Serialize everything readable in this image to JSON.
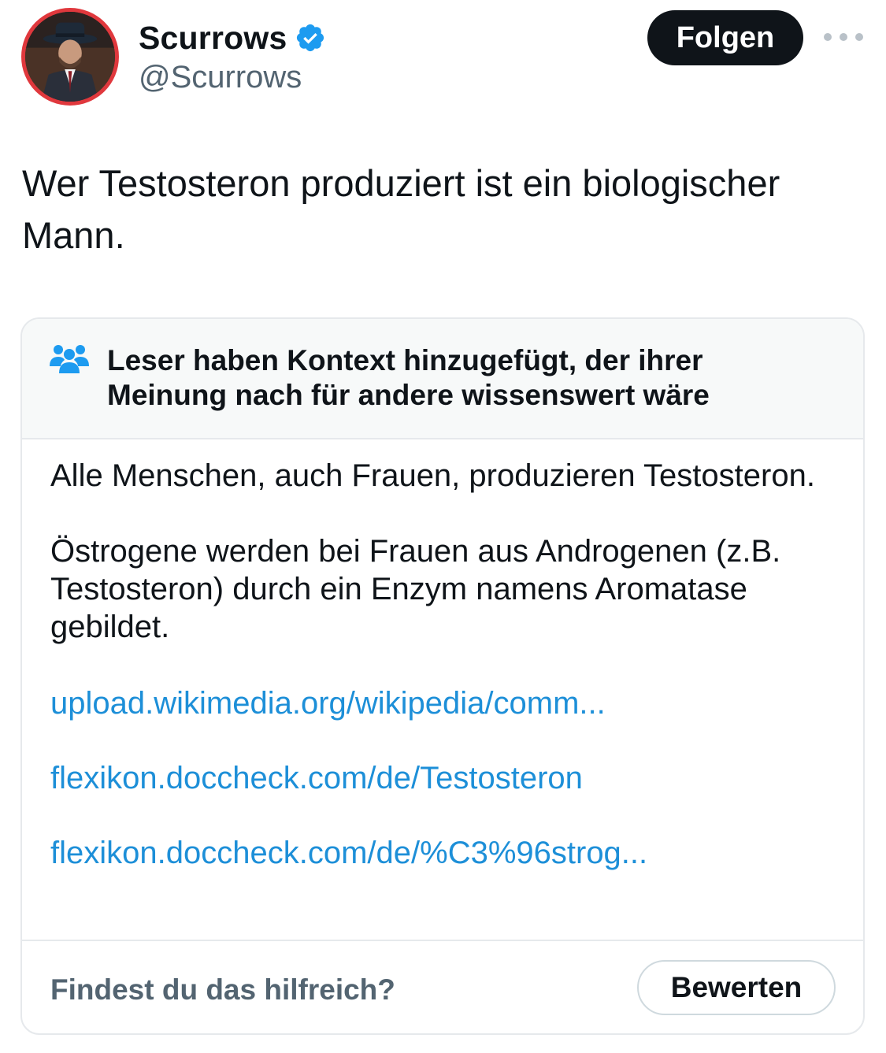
{
  "author": {
    "display_name": "Scurrows",
    "handle": "@Scurrows",
    "verified": true,
    "avatar_icon": "profile-photo-man-in-fedora",
    "avatar_ring_color": "#e0383d"
  },
  "header": {
    "follow_label": "Folgen",
    "more_icon": "ellipsis-icon"
  },
  "tweet": {
    "text": "Wer Testosteron produziert ist ein biologischer Mann."
  },
  "community_note": {
    "icon": "people-icon",
    "title": "Leser haben Kontext hinzugefügt, der ihrer Meinung nach für andere wissenswert wäre",
    "paragraphs": [
      "Alle Menschen, auch Frauen, produzieren Testosteron.",
      "Östrogene werden bei Frauen aus Androgenen (z.B. Testosteron) durch ein Enzym namens Aromatase gebildet."
    ],
    "links": [
      "upload.wikimedia.org/wikipedia/comm...",
      "flexikon.doccheck.com/de/Testosteron",
      "flexikon.doccheck.com/de/%C3%96strog..."
    ],
    "helpful_question": "Findest du das hilfreich?",
    "rate_label": "Bewerten"
  },
  "colors": {
    "text_primary": "#0f1419",
    "text_secondary": "#536471",
    "link": "#1d8fd8",
    "verified_badge": "#1d9bf0",
    "follow_button_bg": "#0f1419",
    "note_header_bg": "#f7f9f9",
    "border": "#e6e9ec"
  }
}
